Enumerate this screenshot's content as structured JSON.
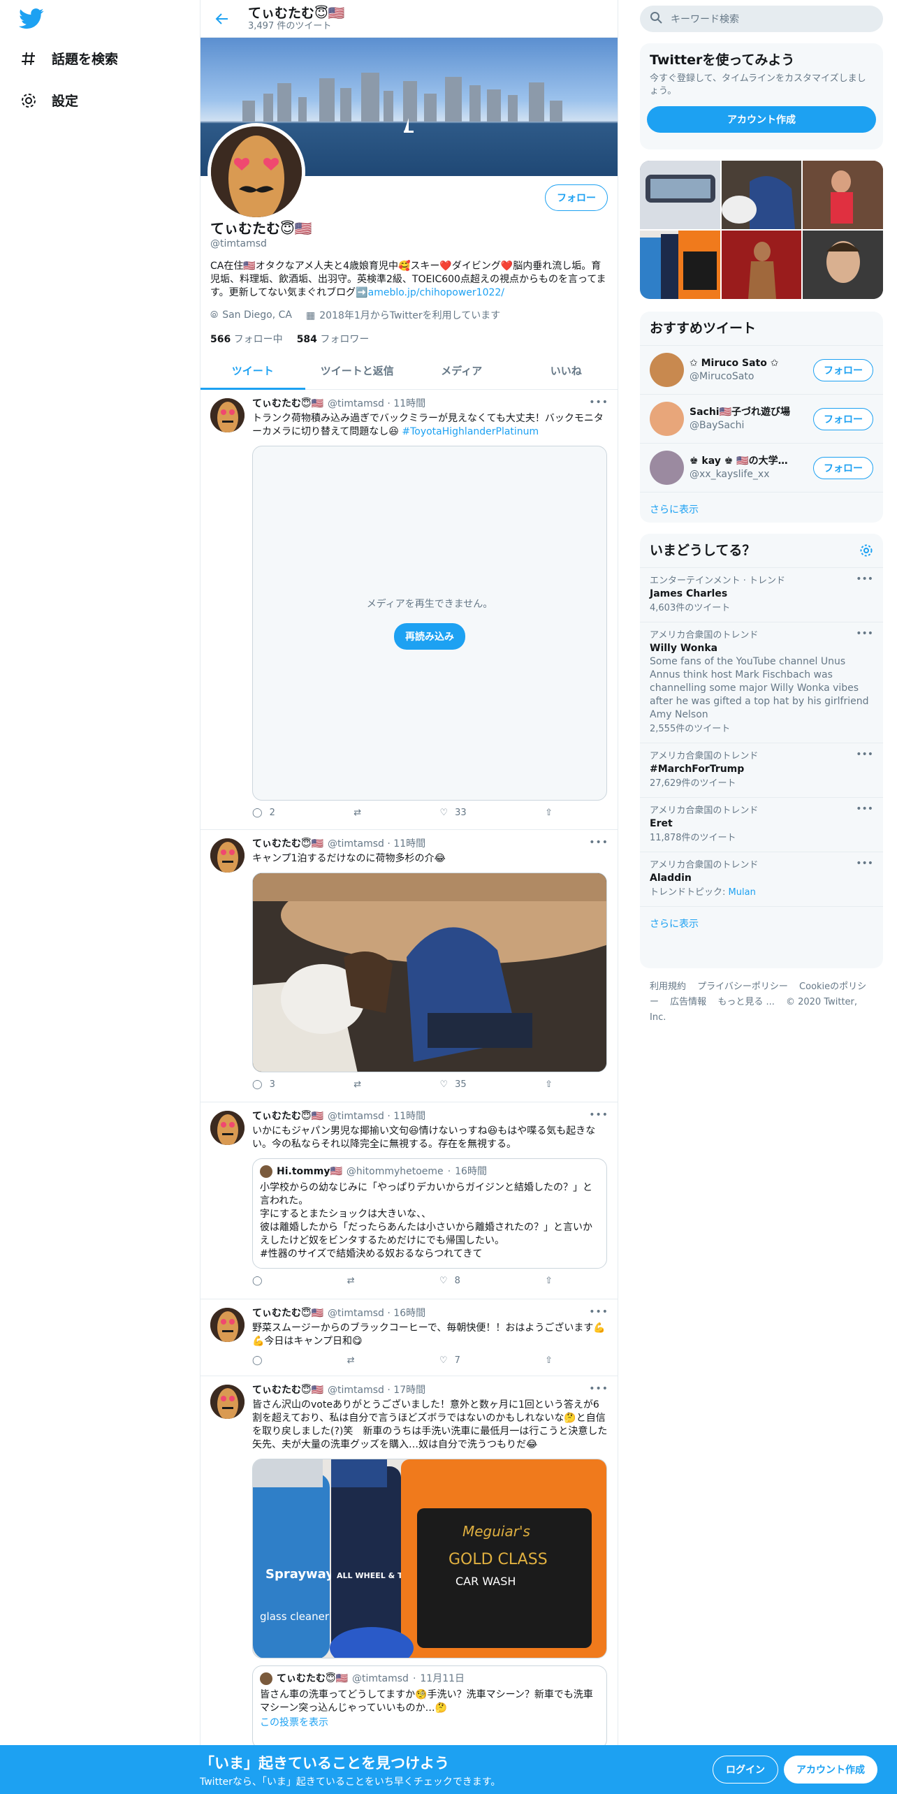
{
  "colors": {
    "accent": "#1da1f2",
    "text": "#14171a",
    "muted": "#657786",
    "bg_light": "#f5f8fa"
  },
  "nav": {
    "logo": "twitter-bird-icon",
    "items": [
      {
        "icon": "hash-icon",
        "label": "話題を検索"
      },
      {
        "icon": "gear-icon",
        "label": "設定"
      }
    ]
  },
  "header": {
    "name": "てぃむたむ😇🇺🇸",
    "tweet_count": "3,497 件のツイート"
  },
  "profile": {
    "name": "てぃむたむ😇🇺🇸",
    "handle": "@timtamsd",
    "follow_label": "フォロー",
    "bio_text": "CA在住🇺🇸オタクなアメ人夫と4歳娘育児中🥰スキー❤️ダイビング❤️脳内垂れ流し垢。育児垢、料理垢、飲酒垢、出羽守。英検準2級、TOEIC600点超えの視点からものを言ってます。更新してない気まぐれブログ➡️",
    "bio_link": "ameblo.jp/chihopower1022/",
    "location": "San Diego, CA",
    "joined": "2018年1月からTwitterを利用しています",
    "following_count": "566",
    "following_label": "フォロー中",
    "followers_count": "584",
    "followers_label": "フォロワー"
  },
  "tabs": [
    "ツイート",
    "ツイートと返信",
    "メディア",
    "いいね"
  ],
  "tweets": [
    {
      "name": "てぃむたむ😇🇺🇸",
      "handle": "@timtamsd",
      "time": "11時間",
      "text": "トランク荷物積み込み過ぎでバックミラーが見えなくても大丈夫！バックモニターカメラに切り替えて問題なし😆",
      "hashtag": "#ToyotaHighlanderPlatinum",
      "media_error": "メディアを再生できません。",
      "reload_label": "再読み込み",
      "replies": "2",
      "retweets": "",
      "likes": "33"
    },
    {
      "name": "てぃむたむ😇🇺🇸",
      "handle": "@timtamsd",
      "time": "11時間",
      "text": "キャンプ1泊するだけなのに荷物多杉の介😂",
      "replies": "3",
      "retweets": "",
      "likes": "35"
    },
    {
      "name": "てぃむたむ😇🇺🇸",
      "handle": "@timtamsd",
      "time": "11時間",
      "text": "いかにもジャパン男児な揶揄い文句😆情けないっすね😆もはや喋る気も起きない。今の私ならそれ以降完全に無視する。存在を無視する。",
      "quote": {
        "name": "Hi.tommy🇺🇸",
        "handle": "@hitommyhetoeme",
        "time": "16時間",
        "text": "小学校からの幼なじみに「やっぱりデカいからガイジンと結婚したの？」と言われた。\n字にするとまたショックは大きいな、、\n彼は離婚したから「だったらあんたは小さいから離婚されたの？」と言いかえしたけど奴をビンタするためだけにでも帰国したい。\n#性器のサイズで結婚決める奴おるならつれてきて"
      },
      "replies": "",
      "retweets": "",
      "likes": "8"
    },
    {
      "name": "てぃむたむ😇🇺🇸",
      "handle": "@timtamsd",
      "time": "16時間",
      "text": "野菜スムージーからのブラックコーヒーで、毎朝快便！！おはようございます💪💪今日はキャンプ日和😋",
      "replies": "",
      "retweets": "",
      "likes": "7"
    },
    {
      "name": "てぃむたむ😇🇺🇸",
      "handle": "@timtamsd",
      "time": "17時間",
      "text": "皆さん沢山のvoteありがとうございました！意外と数ヶ月に1回という答えが6割を超えており、私は自分で言うほどズボラではないのかもしれないな🤔と自信を取り戻しました(?)笑　新車のうちは手洗い洗車に最低月一は行こうと決意した矢先、夫が大量の洗車グッズを購入…奴は自分で洗うつもりだ😂",
      "photo_labels": {
        "spray": "Sprayway",
        "spray2": "glass cleaner",
        "wheel": "ALL WHEEL & TIRE CLEANER",
        "brand": "Meguiar's",
        "gold": "GOLD CLASS",
        "wash": "CAR WASH"
      },
      "quote": {
        "name": "てぃむたむ😇🇺🇸",
        "handle": "@timtamsd",
        "time": "11月11日",
        "text": "皆さん車の洗車ってどうしてますか🧐手洗い？洗車マシーン？新車でも洗車マシーン突っ込んじゃっていいものか…🤔",
        "cut": "この投票を表示"
      }
    }
  ],
  "right": {
    "search_placeholder": "キーワード検索",
    "signup_card": {
      "title": "Twitterを使ってみよう",
      "text": "今すぐ登録して、タイムラインをカスタマイズしましょう。",
      "button": "アカウント作成"
    },
    "recommended": {
      "title": "おすすめツイート",
      "follow_label": "フォロー",
      "more": "さらに表示",
      "users": [
        {
          "name": "✩ Miruco Sato ✩",
          "handle": "@MirucoSato",
          "color": "#c8894f"
        },
        {
          "name": "Sachi🇺🇸子づれ遊び場",
          "handle": "@BaySachi",
          "color": "#e8a67a"
        },
        {
          "name": "♚ kay ♚ 🇺🇸の大学…",
          "handle": "@xx_kayslife_xx",
          "color": "#9b8aa0"
        }
      ]
    },
    "trends": {
      "title": "いまどうしてる？",
      "more": "さらに表示",
      "items": [
        {
          "context": "エンターテインメント · トレンド",
          "title": "James Charles",
          "desc": "",
          "count": "4,603件のツイート"
        },
        {
          "context": "アメリカ合衆国のトレンド",
          "title": "Willy Wonka",
          "desc": "Some fans of the YouTube channel Unus Annus think host Mark Fischbach was channelling some major Willy Wonka vibes after he was gifted a top hat by his girlfriend Amy Nelson",
          "count": "2,555件のツイート"
        },
        {
          "context": "アメリカ合衆国のトレンド",
          "title": "#MarchForTrump",
          "desc": "",
          "count": "27,629件のツイート"
        },
        {
          "context": "アメリカ合衆国のトレンド",
          "title": "Eret",
          "desc": "",
          "count": "11,878件のツイート"
        },
        {
          "context": "アメリカ合衆国のトレンド",
          "title": "Aladdin",
          "desc": "",
          "count": "トレンドトピック:",
          "topic": "Mulan"
        }
      ]
    },
    "footer": {
      "links": [
        "利用規約",
        "プライバシーポリシー",
        "Cookieのポリシー",
        "広告情報",
        "もっと見る ..."
      ],
      "copyright": "© 2020 Twitter, Inc."
    }
  },
  "bottombar": {
    "title": "「いま」起きていることを見つけよう",
    "subtitle": "Twitterなら、「いま」起きていることをいち早くチェックできます。",
    "login": "ログイン",
    "signup": "アカウント作成"
  }
}
